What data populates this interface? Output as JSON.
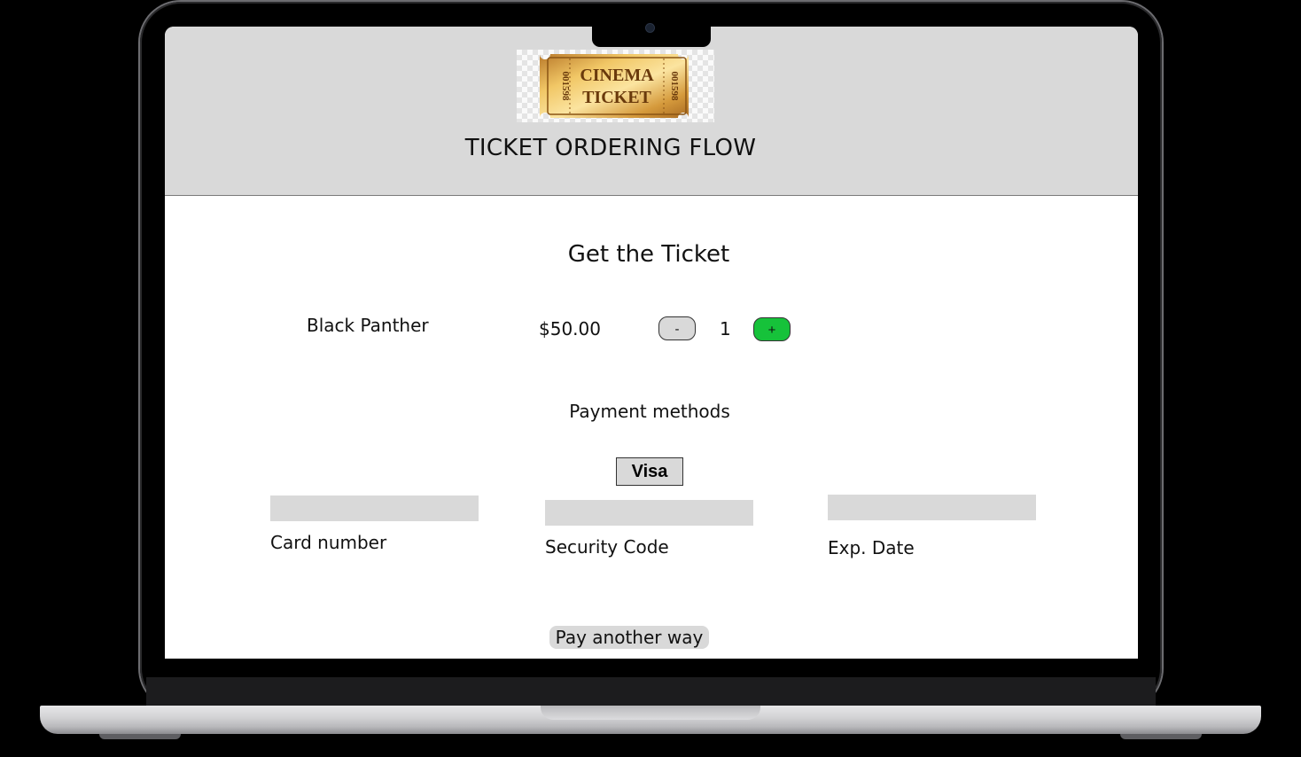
{
  "logo": {
    "line1": "CINEMA",
    "line2": "TICKET",
    "serial_left": "001598",
    "serial_right": "001598"
  },
  "header": {
    "title": "TICKET ORDERING FLOW"
  },
  "main": {
    "title": "Get the Ticket",
    "item": {
      "name": "Black Panther",
      "price": "$50.00",
      "quantity": "1",
      "decrement_label": "-",
      "increment_label": "+"
    },
    "payment": {
      "title": "Payment methods",
      "selected_method": "Visa",
      "fields": {
        "card_number": {
          "label": "Card number",
          "value": "",
          "placeholder": ""
        },
        "security_code": {
          "label": "Security Code",
          "value": "",
          "placeholder": ""
        },
        "exp_date": {
          "label": "Exp. Date",
          "value": "",
          "placeholder": ""
        }
      },
      "alternate_button": "Pay another way"
    }
  },
  "colors": {
    "header_bg": "#d9d9d9",
    "increment_green": "#16c23a",
    "control_gray": "#d9d9d9"
  }
}
